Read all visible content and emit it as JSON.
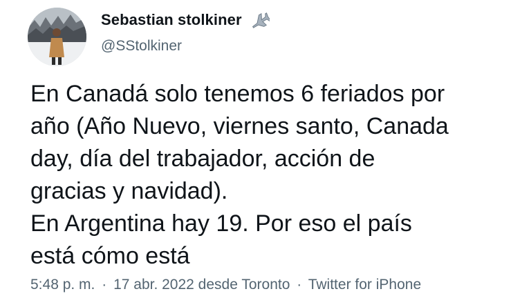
{
  "user": {
    "display_name": "Sebastian stolkiner",
    "handle": "@SStolkiner",
    "avatar_icon": "profile-photo",
    "badge_icon": "airplane-emoji"
  },
  "tweet": {
    "text": "En Canadá solo tenemos 6 feriados por\naño (Año Nuevo, viernes santo, Canada\nday, día del trabajador, acción de\ngracias y navidad).\nEn Argentina hay 19. Por eso el país\nestá cómo está"
  },
  "meta": {
    "time": "5:48 p. m.",
    "separator": "·",
    "date_location": "17 abr. 2022 desde Toronto",
    "source": "Twitter for iPhone"
  },
  "colors": {
    "text_primary": "#0f1419",
    "text_secondary": "#536471",
    "background": "#ffffff"
  }
}
